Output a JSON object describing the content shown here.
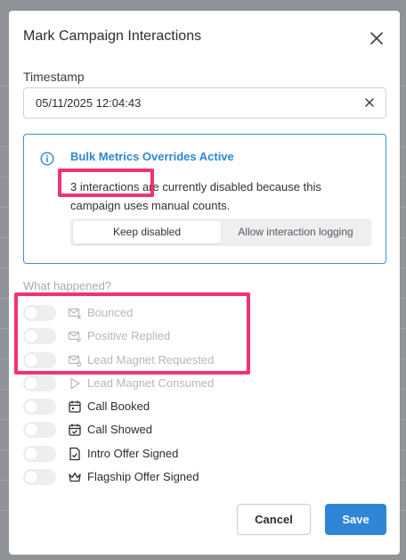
{
  "modal": {
    "title": "Mark Campaign Interactions"
  },
  "timestamp": {
    "label": "Timestamp",
    "value": "05/11/2025 12:04:43"
  },
  "alert": {
    "title": "Bulk Metrics Overrides Active",
    "count_text": "3 interactions",
    "body_rest": " are currently disabled because this campaign uses manual counts.",
    "options": [
      "Keep disabled",
      "Allow interaction logging"
    ],
    "selected_option": "Keep disabled"
  },
  "section": {
    "label": "What happened?"
  },
  "interactions": [
    {
      "label": "Bounced",
      "icon": "mail-x-icon",
      "enabled": false
    },
    {
      "label": "Positive Replied",
      "icon": "mail-check-icon",
      "enabled": false
    },
    {
      "label": "Lead Magnet Requested",
      "icon": "mail-magnet-icon",
      "enabled": false
    },
    {
      "label": "Lead Magnet Consumed",
      "icon": "play-icon",
      "enabled": false
    },
    {
      "label": "Call Booked",
      "icon": "calendar-icon",
      "enabled": true
    },
    {
      "label": "Call Showed",
      "icon": "calendar-check-icon",
      "enabled": true
    },
    {
      "label": "Intro Offer Signed",
      "icon": "file-signature-icon",
      "enabled": true
    },
    {
      "label": "Flagship Offer Signed",
      "icon": "crown-icon",
      "enabled": true
    }
  ],
  "footer": {
    "cancel_label": "Cancel",
    "save_label": "Save"
  },
  "colors": {
    "accent": "#2f86d6",
    "highlight": "#f2336f",
    "disabled_text": "#b4b8bc",
    "backdrop": "#8f9296"
  }
}
